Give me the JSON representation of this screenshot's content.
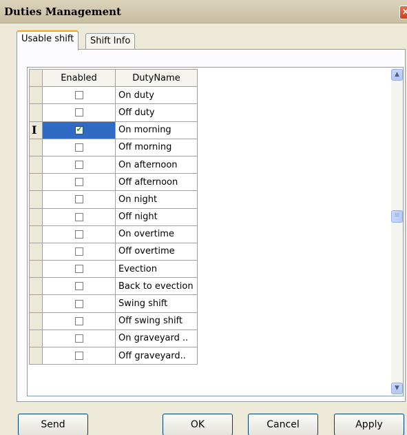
{
  "window": {
    "title": "Duties Management",
    "close_glyph": "×"
  },
  "tabs": [
    {
      "label": "Usable shift",
      "active": true
    },
    {
      "label": "Shift Info",
      "active": false
    }
  ],
  "grid": {
    "columns": [
      "Enabled",
      "DutyName"
    ],
    "selected_row": 2,
    "rows": [
      {
        "enabled": false,
        "name": "On duty"
      },
      {
        "enabled": false,
        "name": "Off duty"
      },
      {
        "enabled": true,
        "name": "On morning"
      },
      {
        "enabled": false,
        "name": "Off morning"
      },
      {
        "enabled": false,
        "name": "On afternoon"
      },
      {
        "enabled": false,
        "name": "Off afternoon"
      },
      {
        "enabled": false,
        "name": "On night"
      },
      {
        "enabled": false,
        "name": "Off night"
      },
      {
        "enabled": false,
        "name": "On overtime"
      },
      {
        "enabled": false,
        "name": "Off overtime"
      },
      {
        "enabled": false,
        "name": "Evection"
      },
      {
        "enabled": false,
        "name": "Back to evection"
      },
      {
        "enabled": false,
        "name": "Swing shift"
      },
      {
        "enabled": false,
        "name": "Off swing shift"
      },
      {
        "enabled": false,
        "name": "On graveyard .."
      },
      {
        "enabled": false,
        "name": "Off graveyard.."
      }
    ],
    "row_cursor_glyph": "I",
    "check_glyph": "✔"
  },
  "scrollbar": {
    "up_glyph": "▲",
    "down_glyph": "▼",
    "thumb_glyph": "≡"
  },
  "buttons": {
    "send": "Send",
    "ok": "OK",
    "cancel": "Cancel",
    "apply": "Apply"
  },
  "colors": {
    "selection": "#316ac5",
    "check": "#21a121",
    "tab_highlight": "#f6a21c"
  }
}
